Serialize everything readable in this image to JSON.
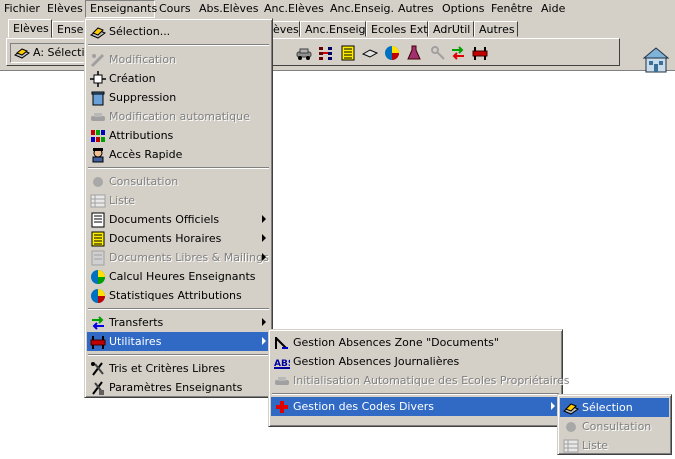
{
  "menubar": [
    "Fichier",
    "Elèves",
    "Enseignants",
    "Cours",
    "Abs.Elèves",
    "Anc.Elèves",
    "Anc.Enseig.",
    "Autres",
    "Options",
    "Fenêtre",
    "Aide"
  ],
  "tabs": [
    "Elèves",
    "Enseig",
    "èves",
    "Anc.Enseig",
    "Ecoles Ext",
    "AdrUtil",
    "Autres"
  ],
  "combo": {
    "value": "A: Sélectio"
  },
  "menu1": {
    "items": [
      {
        "label": "Sélection...",
        "enabled": true,
        "icon": "selection-icon"
      },
      {
        "label": "Modification",
        "enabled": false,
        "icon": "modification-icon"
      },
      {
        "label": "Création",
        "enabled": true,
        "icon": "creation-icon"
      },
      {
        "label": "Suppression",
        "enabled": true,
        "icon": "suppression-icon"
      },
      {
        "label": "Modification automatique",
        "enabled": false,
        "icon": "auto-modification-icon"
      },
      {
        "label": "Attributions",
        "enabled": true,
        "icon": "attributions-icon"
      },
      {
        "label": "Accès Rapide",
        "enabled": true,
        "icon": "quick-access-icon"
      },
      {
        "label": "Consultation",
        "enabled": false,
        "icon": "consultation-icon"
      },
      {
        "label": "Liste",
        "enabled": false,
        "icon": "list-icon"
      },
      {
        "label": "Documents Officiels",
        "enabled": true,
        "icon": "documents-icon",
        "submenu": true
      },
      {
        "label": "Documents Horaires",
        "enabled": true,
        "icon": "schedule-icon",
        "submenu": true
      },
      {
        "label": "Documents Libres & Mailings",
        "enabled": false,
        "icon": "mailing-icon",
        "submenu": true
      },
      {
        "label": "Calcul Heures Enseignants",
        "enabled": true,
        "icon": "hours-pie-icon"
      },
      {
        "label": "Statistiques Attributions",
        "enabled": true,
        "icon": "stats-pie-icon"
      },
      {
        "label": "Transferts",
        "enabled": true,
        "icon": "transfer-arrows-icon",
        "submenu": true
      },
      {
        "label": "Utilitaires",
        "enabled": true,
        "icon": "tools-icon",
        "submenu": true,
        "highlighted": true
      },
      {
        "label": "Tris et Critères Libres",
        "enabled": true,
        "icon": "sort-icon"
      },
      {
        "label": "Paramètres Enseignants",
        "enabled": true,
        "icon": "parameters-icon"
      }
    ]
  },
  "menu2": {
    "items": [
      {
        "label": "Gestion Absences Zone \"Documents\"",
        "enabled": true,
        "icon": "absence-zone-icon"
      },
      {
        "label": "Gestion Absences Journalières",
        "enabled": true,
        "icon": "abs-icon"
      },
      {
        "label": "Initialisation Automatique des Ecoles Propriétaires",
        "enabled": false,
        "icon": "init-icon"
      },
      {
        "label": "Gestion des Codes Divers",
        "enabled": true,
        "icon": "red-cross-icon",
        "submenu": true,
        "highlighted": true
      }
    ]
  },
  "menu3": {
    "items": [
      {
        "label": "Sélection",
        "enabled": true,
        "icon": "selection-icon",
        "highlighted": true
      },
      {
        "label": "Consultation",
        "enabled": false,
        "icon": "consultation-icon"
      },
      {
        "label": "Liste",
        "enabled": false,
        "icon": "list-icon"
      }
    ]
  },
  "colors": {
    "highlight": "#316ac5",
    "face": "#d4d0c8"
  }
}
